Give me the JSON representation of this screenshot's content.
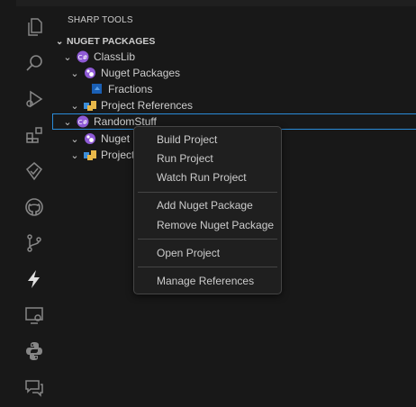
{
  "sidebar": {
    "title": "SHARP TOOLS",
    "section": "NUGET PACKAGES",
    "tree": [
      {
        "label": "ClassLib",
        "icon": "csharp-project-icon"
      },
      {
        "label": "Nuget Packages",
        "icon": "nuget-icon"
      },
      {
        "label": "Fractions",
        "icon": "package-icon"
      },
      {
        "label": "Project References",
        "icon": "references-icon"
      },
      {
        "label": "RandomStuff",
        "icon": "csharp-project-icon"
      },
      {
        "label": "Nuget P",
        "icon": "nuget-icon"
      },
      {
        "label": "Project I",
        "icon": "references-icon"
      }
    ]
  },
  "context_menu": {
    "items": [
      "Build Project",
      "Run Project",
      "Watch Run Project",
      "Add Nuget Package",
      "Remove Nuget Package",
      "Open Project",
      "Manage References"
    ]
  },
  "activity_bar": {
    "icons": [
      "explorer-icon",
      "search-icon",
      "run-debug-icon",
      "extensions-icon",
      "testing-icon",
      "github-icon",
      "source-control-icon",
      "sharp-tools-icon",
      "remote-explorer-icon",
      "python-icon",
      "comments-icon"
    ]
  },
  "colors": {
    "accent": "#2a8bd8",
    "csharp": "#8f5ad6",
    "background": "#181818"
  }
}
